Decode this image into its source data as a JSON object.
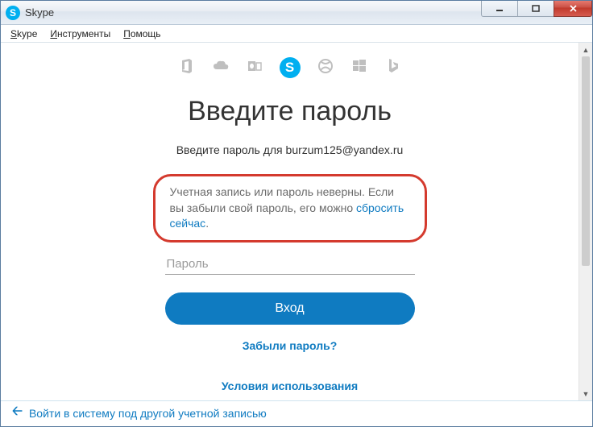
{
  "window": {
    "title": "Skype"
  },
  "menu": {
    "skype": "Skype",
    "tools": "Инструменты",
    "help": "Помощь"
  },
  "page": {
    "heading": "Введите пароль",
    "subtext_prefix": "Введите пароль для ",
    "email": "burzum125@yandex.ru",
    "error_text": "Учетная запись или пароль неверны. Если вы забыли свой пароль, его можно ",
    "error_link": "сбросить сейчас",
    "error_suffix": ".",
    "password_placeholder": "Пароль",
    "signin_label": "Вход",
    "forgot_label": "Забыли пароль?",
    "terms_label": "Условия использования",
    "back_label": "Войти в систему под другой учетной записью"
  },
  "icons": {
    "skype_letter": "S"
  }
}
